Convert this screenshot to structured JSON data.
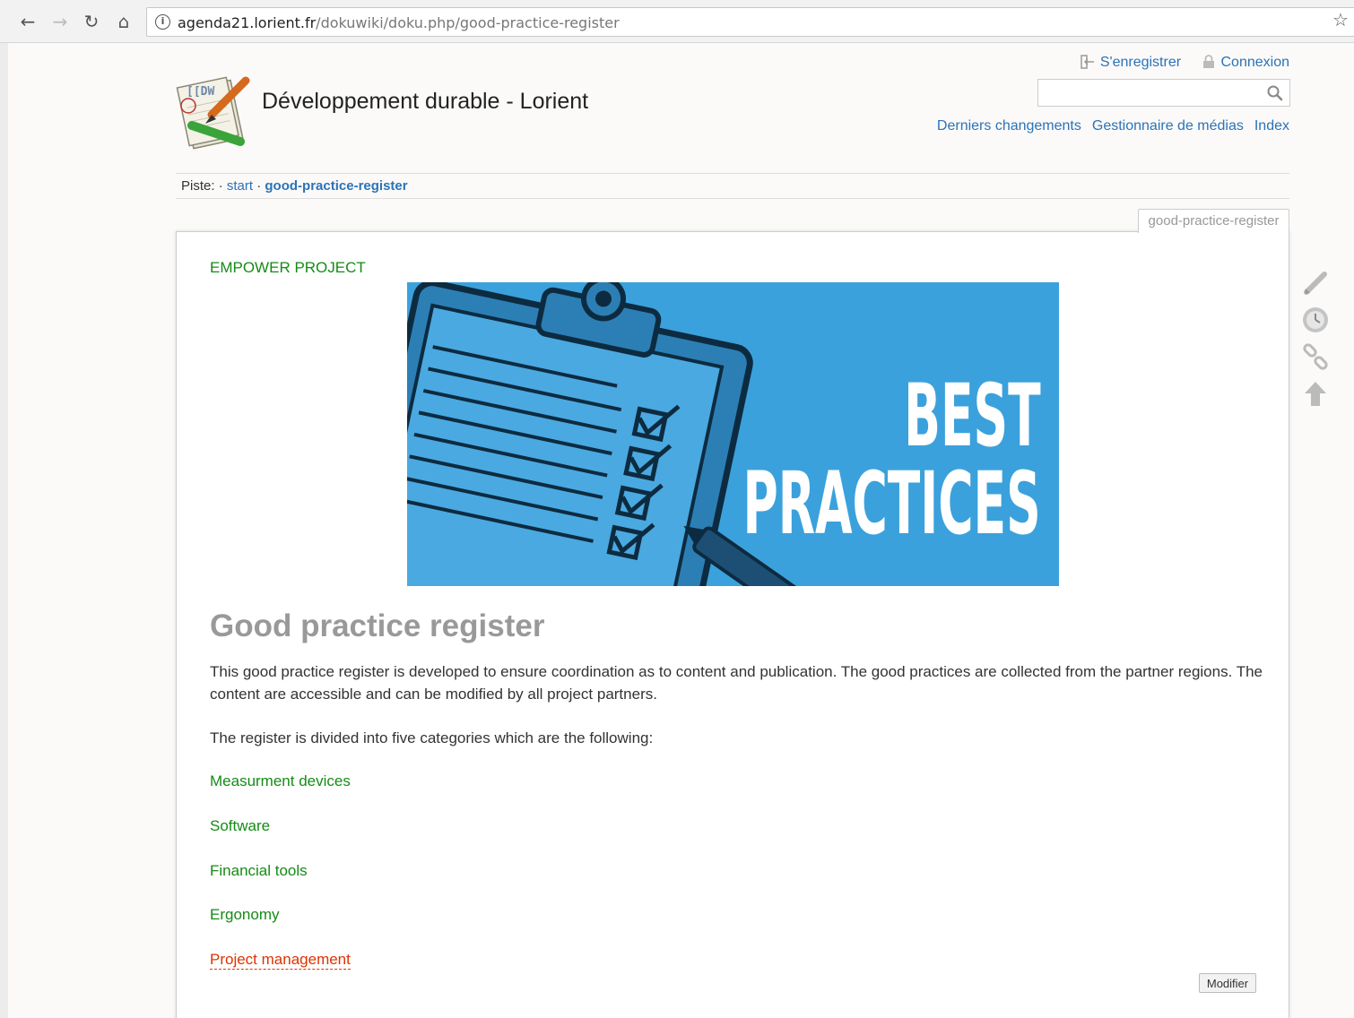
{
  "browser": {
    "url_host": "agenda21.lorient.fr",
    "url_path": "/dokuwiki/doku.php/good-practice-register"
  },
  "header": {
    "site_title": "Développement durable - Lorient",
    "logo_text": "[[DW",
    "user_tools": {
      "register": "S'enregistrer",
      "login": "Connexion"
    },
    "site_tools": [
      "Derniers changements",
      "Gestionnaire de médias",
      "Index"
    ],
    "search": {
      "value": ""
    }
  },
  "breadcrumb": {
    "label": "Piste:",
    "sep": "·",
    "items": [
      "start",
      "good-practice-register"
    ]
  },
  "page_tab": "good-practice-register",
  "content": {
    "project_link": "EMPOWER PROJECT",
    "banner": {
      "line1": "BEST",
      "line2": "PRACTICES"
    },
    "heading": "Good practice register",
    "para1": "This good practice register is developed to ensure coordination as to content and publication. The good practices are collected from the partner regions. The content are accessible and can be modified by all project partners.",
    "para2": "The register is divided into five categories which are the following:",
    "categories": [
      "Measurment devices",
      "Software",
      "Financial tools",
      "Ergonomy",
      "Project management"
    ],
    "edit_button": "Modifier"
  },
  "colors": {
    "link_blue": "#2b73b7",
    "link_green": "#158b16",
    "link_missing": "#dd3300",
    "banner_blue": "#3ba1dc"
  }
}
